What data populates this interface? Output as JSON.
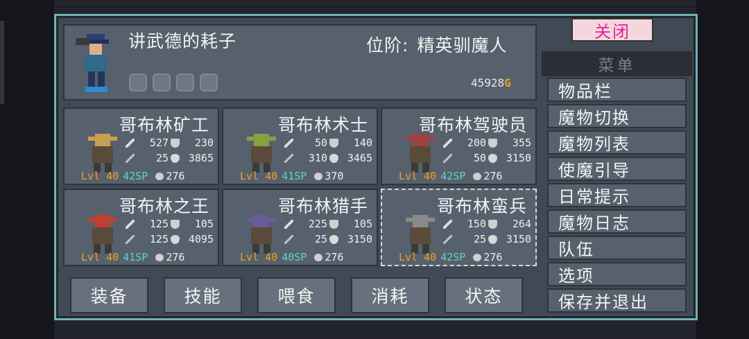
{
  "hero": {
    "name": "讲武德的耗子",
    "rank_label": "位阶:",
    "rank_value": "精英驯魔人",
    "gold": "45928",
    "gold_unit": "G",
    "slot_icons": [
      "boot-icon",
      "gauntlet-icon",
      "mushroom-icon",
      "ring-icon"
    ]
  },
  "monsters": [
    {
      "name": "哥布林矿工",
      "atk": "527",
      "def": "230",
      "mag": "25",
      "hp": "3865",
      "level": "Lvl 40",
      "sp": "42SP",
      "food": "276"
    },
    {
      "name": "哥布林术士",
      "atk": "50",
      "def": "140",
      "mag": "310",
      "hp": "3465",
      "level": "Lvl 40",
      "sp": "41SP",
      "food": "370"
    },
    {
      "name": "哥布林驾驶员",
      "atk": "200",
      "def": "355",
      "mag": "50",
      "hp": "3150",
      "level": "Lvl 40",
      "sp": "42SP",
      "food": "276"
    },
    {
      "name": "哥布林之王",
      "atk": "125",
      "def": "105",
      "mag": "125",
      "hp": "4095",
      "level": "Lvl 40",
      "sp": "41SP",
      "food": "276"
    },
    {
      "name": "哥布林猎手",
      "atk": "225",
      "def": "105",
      "mag": "25",
      "hp": "3150",
      "level": "Lvl 40",
      "sp": "40SP",
      "food": "276"
    },
    {
      "name": "哥布林蛮兵",
      "atk": "150",
      "def": "264",
      "mag": "25",
      "hp": "3150",
      "level": "Lvl 40",
      "sp": "42SP",
      "food": "276"
    }
  ],
  "actions": [
    "装备",
    "技能",
    "喂食",
    "消耗",
    "状态"
  ],
  "menu": {
    "close_label": "关闭",
    "title": "菜单",
    "items": [
      "物品栏",
      "魔物切换",
      "魔物列表",
      "使魔引导",
      "日常提示",
      "魔物日志",
      "队伍",
      "选项",
      "保存并退出"
    ]
  },
  "colors": {
    "level": "#f0a020",
    "sp": "#5ed4c8",
    "close_text": "#e0209a",
    "frame": "#6fb3b8"
  }
}
